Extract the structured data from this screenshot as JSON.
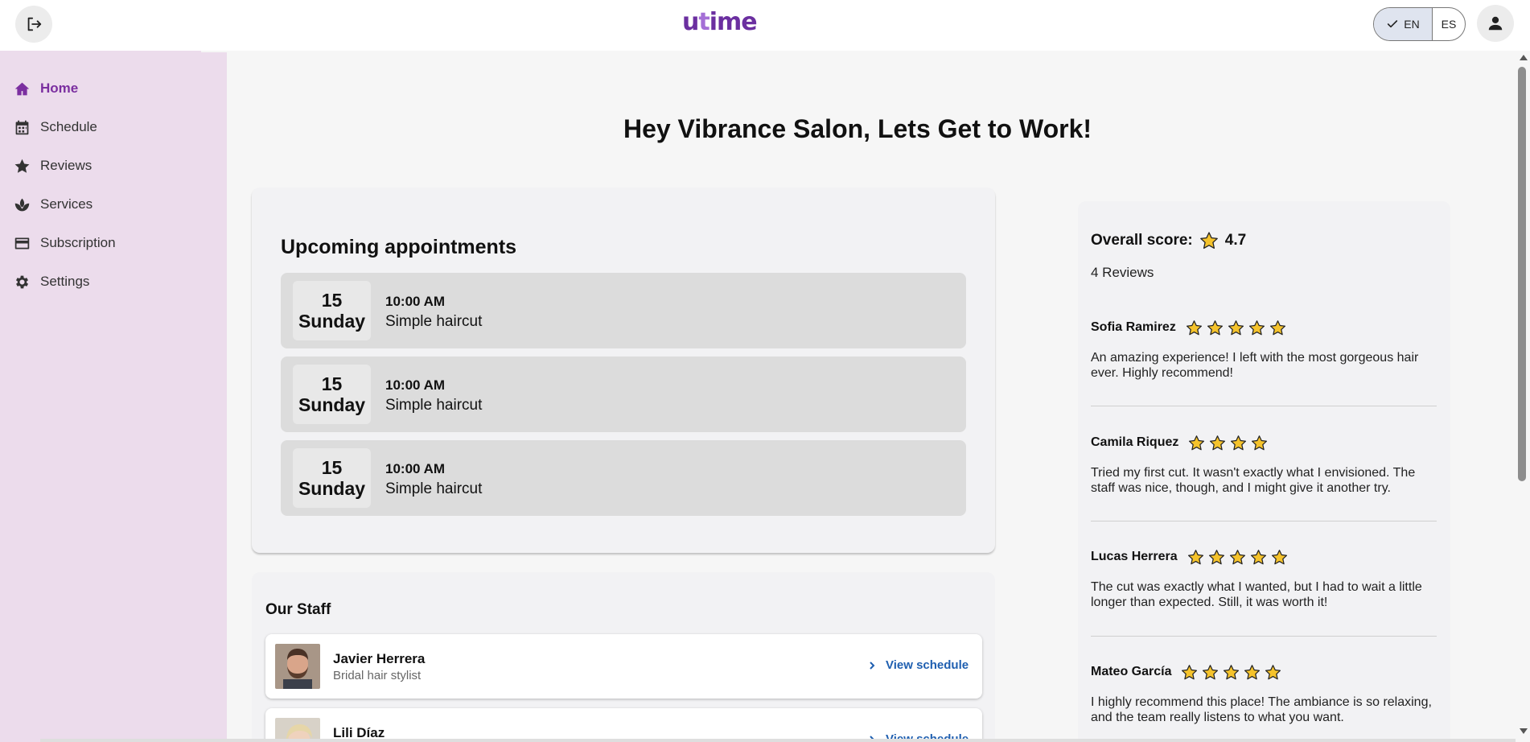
{
  "topbar": {
    "logo_prefix": "u",
    "logo_t": "t",
    "logo_suffix": "ime",
    "lang_active": "EN",
    "lang_inactive": "ES"
  },
  "sidebar": {
    "items": [
      {
        "label": "Home",
        "icon": "home-icon"
      },
      {
        "label": "Schedule",
        "icon": "calendar-icon"
      },
      {
        "label": "Reviews",
        "icon": "star-icon"
      },
      {
        "label": "Services",
        "icon": "lotus-icon"
      },
      {
        "label": "Subscription",
        "icon": "card-icon"
      },
      {
        "label": "Settings",
        "icon": "gear-icon"
      }
    ],
    "active_color": "#7b2fa0"
  },
  "main": {
    "greeting": "Hey Vibrance Salon, Lets Get to Work!"
  },
  "appointments": {
    "title": "Upcoming appointments",
    "items": [
      {
        "day": "15",
        "weekday": "Sunday",
        "time": "10:00 AM",
        "service": "Simple haircut"
      },
      {
        "day": "15",
        "weekday": "Sunday",
        "time": "10:00 AM",
        "service": "Simple haircut"
      },
      {
        "day": "15",
        "weekday": "Sunday",
        "time": "10:00 AM",
        "service": "Simple haircut"
      }
    ]
  },
  "staff": {
    "title": "Our Staff",
    "view_label": "View schedule",
    "members": [
      {
        "name": "Javier Herrera",
        "role": "Bridal hair stylist"
      },
      {
        "name": "Lili Díaz",
        "role": ""
      }
    ]
  },
  "reviews": {
    "score_label": "Overall score:",
    "score": "4.7",
    "count_text": "4 Reviews",
    "star_color": "#f5c32c",
    "items": [
      {
        "name": "Sofia Ramirez",
        "stars": 5,
        "text": "An amazing experience! I left with the most gorgeous hair ever. Highly recommend!"
      },
      {
        "name": "Camila Riquez",
        "stars": 4,
        "text": "Tried my first cut. It wasn't exactly what I envisioned. The staff was nice, though, and I might give it another try."
      },
      {
        "name": "Lucas Herrera",
        "stars": 5,
        "text": "The cut was exactly what I wanted, but I had to wait a little longer than expected. Still, it was worth it!"
      },
      {
        "name": "Mateo García",
        "stars": 5,
        "text": "I highly recommend this place! The ambiance is so relaxing, and the team really listens to what you want."
      }
    ]
  }
}
